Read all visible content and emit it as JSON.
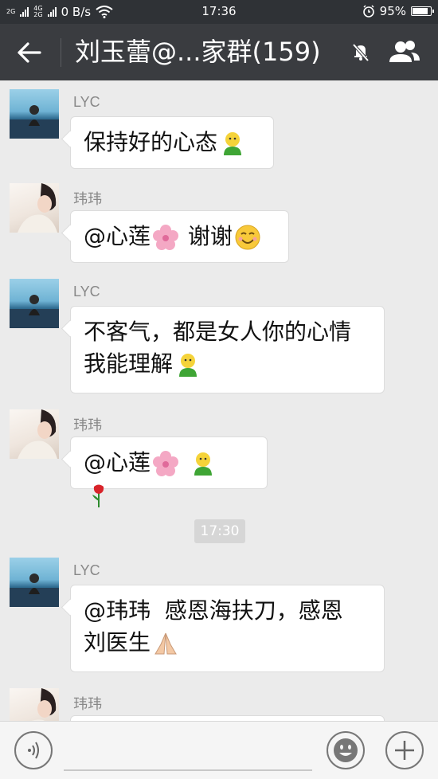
{
  "status_bar": {
    "network_top": "2G",
    "network_4g": "4G",
    "network_2g": "2G",
    "speed": "0 B/s",
    "time": "17:36",
    "battery": "95%",
    "battery_level": 0.95
  },
  "header": {
    "title": "刘玉蕾@...家群(159)"
  },
  "messages": [
    {
      "sender": "LYC",
      "lines": [
        "保持好的心态"
      ]
    },
    {
      "sender": "玮玮",
      "lines": [
        "@心莲",
        "谢谢"
      ]
    },
    {
      "sender": "LYC",
      "lines": [
        "不客气，都是女人你的心情",
        "我能理解"
      ]
    },
    {
      "sender": "玮玮",
      "lines": [
        "@心莲"
      ]
    },
    {
      "sender": "LYC",
      "lines": [
        "@玮玮  感恩海扶刀，感恩",
        "刘医生"
      ]
    },
    {
      "sender": "玮玮",
      "lines": []
    }
  ],
  "timestamp": "17:30",
  "colors": {
    "title_bar": "#3a3c40",
    "status_bar": "#2f3236",
    "chat_bg": "#ebebeb",
    "bubble": "#ffffff"
  },
  "icons": [
    "back-arrow-icon",
    "mute-bell-icon",
    "group-members-icon",
    "voice-icon",
    "emoji-icon",
    "plus-icon",
    "person-emoji-icon",
    "flower-emoji-icon",
    "smile-emoji-icon",
    "rose-emoji-icon",
    "pray-emoji-icon"
  ]
}
